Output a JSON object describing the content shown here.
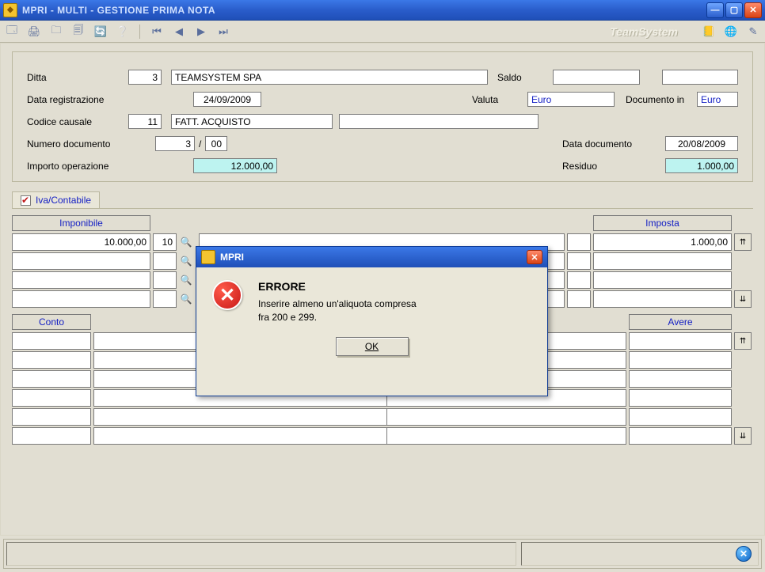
{
  "window": {
    "title": "MPRI  - MULTI -  GESTIONE PRIMA NOTA",
    "brand": "TeamSystem"
  },
  "form": {
    "ditta_label": "Ditta",
    "ditta_code": "3",
    "ditta_name": "TEAMSYSTEM SPA",
    "saldo_label": "Saldo",
    "saldo_value": "",
    "valuta_label": "Valuta",
    "valuta_value": "Euro",
    "documento_in_label": "Documento in",
    "documento_in_value": "Euro",
    "data_reg_label": "Data registrazione",
    "data_reg_value": "24/09/2009",
    "codice_causale_label": "Codice causale",
    "codice_causale_code": "11",
    "codice_causale_desc": "FATT. ACQUISTO",
    "codice_causale_extra": "",
    "numero_doc_label": "Numero documento",
    "numero_doc_value": "3",
    "numero_doc_sep": "/",
    "numero_doc_suffix": "00",
    "data_doc_label": "Data documento",
    "data_doc_value": "20/08/2009",
    "importo_label": "Importo operazione",
    "importo_value": "12.000,00",
    "residuo_label": "Residuo",
    "residuo_value": "1.000,00",
    "tab_iva": "Iva/Contabile"
  },
  "headers": {
    "imponibile": "Imponibile",
    "imposta": "Imposta",
    "conto": "Conto",
    "avere": "Avere"
  },
  "grid": {
    "imponibile": [
      "10.000,00",
      "",
      "",
      ""
    ],
    "aliq": [
      "10",
      "",
      "",
      ""
    ],
    "imposta": [
      "1.000,00",
      "",
      "",
      ""
    ]
  },
  "dialog": {
    "title": "MPRI",
    "heading": "ERRORE",
    "line1": "Inserire almeno un'aliquota compresa",
    "line2": "fra 200 e 299.",
    "ok": "OK"
  }
}
